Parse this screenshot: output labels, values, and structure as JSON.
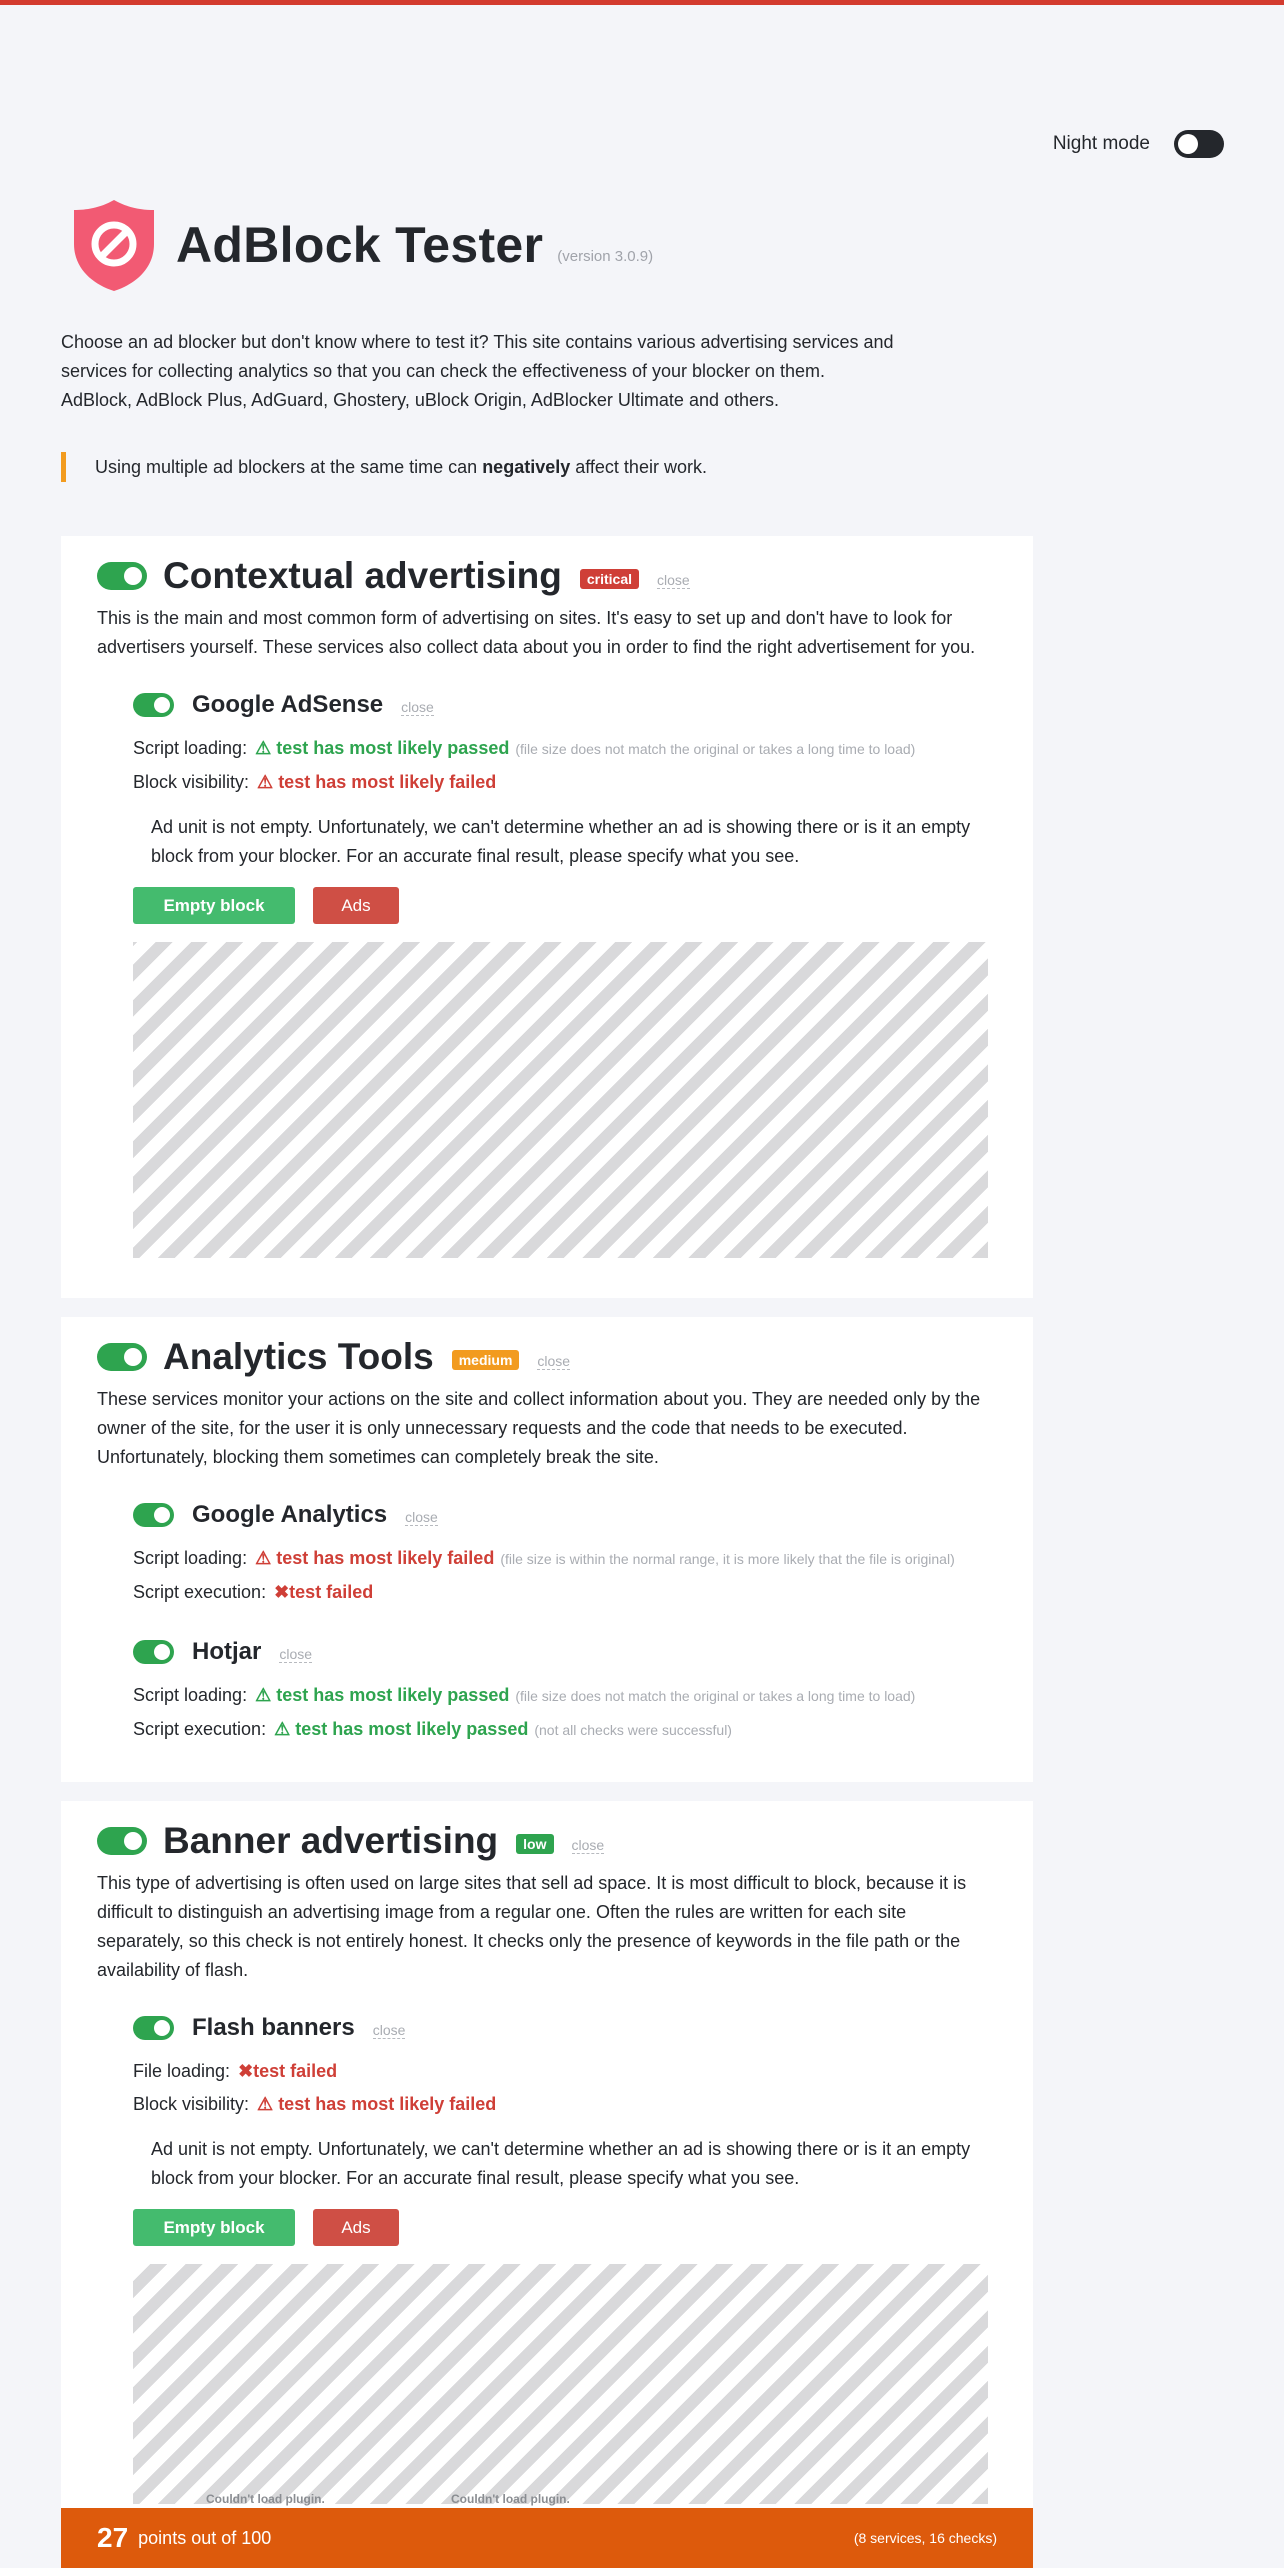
{
  "night_mode": {
    "label": "Night mode",
    "enabled": false
  },
  "header": {
    "title": "AdBlock Tester",
    "version": "(version 3.0.9)",
    "logo_icon": "shield-block-icon"
  },
  "intro": {
    "line1": "Choose an ad blocker but don't know where to test it? This site contains various advertising services and services for collecting analytics so that you can check the effectiveness of your blocker on them.",
    "line2": "AdBlock, AdBlock Plus, AdGuard, Ghostery, uBlock Origin, AdBlocker Ultimate and others."
  },
  "notice": {
    "before": "Using multiple ad blockers at the same time can ",
    "bold": "negatively",
    "after": " affect their work."
  },
  "colors": {
    "accent": "#d33b2f",
    "toggle_on": "#2ea44f",
    "pass": "#2ea44f",
    "fail": "#cf3f37",
    "critical": "#cf3f37",
    "medium": "#f29b1f",
    "low": "#2ea44f",
    "score_bar": "#dd5a0c"
  },
  "sections": [
    {
      "title": "Contextual advertising",
      "badge": "critical",
      "close": "close",
      "description": "This is the main and most common form of advertising on sites. It's easy to set up and don't have to look for advertisers yourself. These services also collect data about you in order to find the right advertisement for you.",
      "services": [
        {
          "title": "Google AdSense",
          "close": "close",
          "checks": [
            {
              "label": "Script loading:",
              "icon": "⚠",
              "result": "test has most likely passed",
              "status": "pass",
              "note": "(file size does not match the original or takes a long time to load)"
            },
            {
              "label": "Block visibility:",
              "icon": "⚠",
              "result": "test has most likely failed",
              "status": "fail",
              "note": ""
            }
          ],
          "hint": "Ad unit is not empty. Unfortunately, we can't determine whether an ad is showing there or is it an empty block from your blocker. For an accurate final result, please specify what you see.",
          "empty_button": "Empty block",
          "ads_button": "Ads"
        }
      ]
    },
    {
      "title": "Analytics Tools",
      "badge": "medium",
      "close": "close",
      "description": "These services monitor your actions on the site and collect information about you. They are needed only by the owner of the site, for the user it is only unnecessary requests and the code that needs to be executed. Unfortunately, blocking them sometimes can completely break the site.",
      "services": [
        {
          "title": "Google Analytics",
          "close": "close",
          "checks": [
            {
              "label": "Script loading:",
              "icon": "⚠",
              "result": "test has most likely failed",
              "status": "fail",
              "note": "(file size is within the normal range, it is more likely that the file is original)"
            },
            {
              "label": "Script execution:",
              "icon": "✖",
              "result": "test failed",
              "status": "fail",
              "note": ""
            }
          ]
        },
        {
          "title": "Hotjar",
          "close": "close",
          "checks": [
            {
              "label": "Script loading:",
              "icon": "⚠",
              "result": "test has most likely passed",
              "status": "pass",
              "note": "(file size does not match the original or takes a long time to load)"
            },
            {
              "label": "Script execution:",
              "icon": "⚠",
              "result": "test has most likely passed",
              "status": "pass",
              "note": "(not all checks were successful)"
            }
          ]
        }
      ]
    },
    {
      "title": "Banner advertising",
      "badge": "low",
      "close": "close",
      "description": "This type of advertising is often used on large sites that sell ad space. It is most difficult to block, because it is difficult to distinguish an advertising image from a regular one. Often the rules are written for each site separately, so this check is not entirely honest. It checks only the presence of keywords in the file path or the availability of flash.",
      "services": [
        {
          "title": "Flash banners",
          "close": "close",
          "checks": [
            {
              "label": "File loading:",
              "icon": "✖",
              "result": "test failed",
              "status": "fail",
              "note": ""
            },
            {
              "label": "Block visibility:",
              "icon": "⚠",
              "result": "test has most likely failed",
              "status": "fail",
              "note": ""
            }
          ],
          "hint": "Ad unit is not empty. Unfortunately, we can't determine whether an ad is showing there or is it an empty block from your blocker. For an accurate final result, please specify what you see.",
          "empty_button": "Empty block",
          "ads_button": "Ads",
          "plugin_messages": [
            "Couldn't load plugin.",
            "Couldn't load plugin."
          ]
        }
      ]
    }
  ],
  "score": {
    "points": "27",
    "text": "points out of 100",
    "meta": "(8 services, 16 checks)"
  }
}
